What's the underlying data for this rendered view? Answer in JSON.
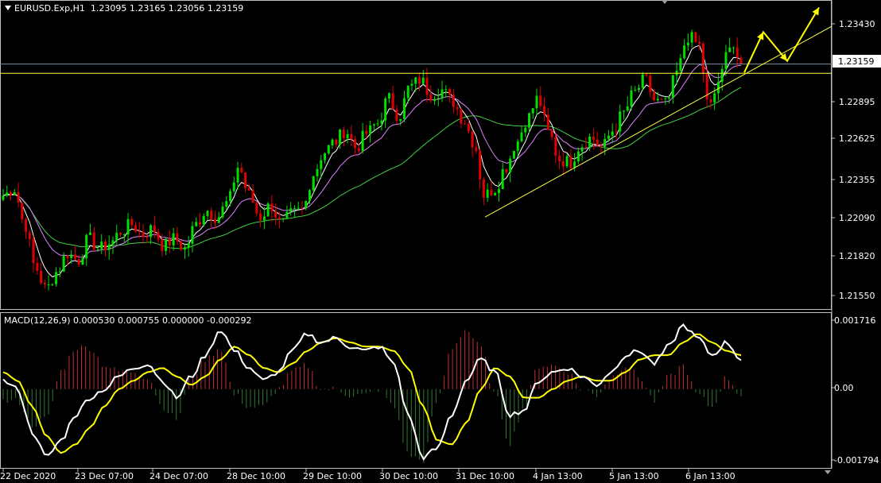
{
  "price_pane": {
    "symbol": "EURUSD.Exp,H1",
    "ohlc": "1.23095 1.23165 1.23056 1.23159",
    "current_price_label": "1.23159",
    "y_ticks": [
      "1.23430",
      "1.23159",
      "1.22895",
      "1.22625",
      "1.22355",
      "1.22090",
      "1.21820",
      "1.21550"
    ]
  },
  "macd_pane": {
    "title": "MACD(12,26,9) 0.000530 0.000755 0.000000 -0.000292",
    "y_ticks": [
      "0.001716",
      "0.00",
      "-0.001794"
    ]
  },
  "time_axis": {
    "labels": [
      "22 Dec 2020",
      "23 Dec 07:00",
      "24 Dec 07:00",
      "28 Dec 10:00",
      "29 Dec 10:00",
      "30 Dec 10:00",
      "31 Dec 10:00",
      "4 Jan 13:00",
      "5 Jan 13:00",
      "6 Jan 13:00"
    ]
  },
  "colors": {
    "background": "#000000",
    "bull_candle": "#00e000",
    "bear_candle": "#e00000",
    "macd_line": "#ffffff",
    "signal_line": "#ffff00",
    "hist_positive": "#c03030",
    "hist_negative": "#2f7a2f",
    "ma_white": "#ffffff",
    "ma_violet": "#e080ff",
    "ma_green": "#40d040",
    "horizontal_level": "#ffff40",
    "trendline": "#ffff40",
    "arrow": "#ffff00",
    "grid_line": "#8090a0"
  },
  "chart_data": [
    {
      "type": "candlestick",
      "symbol": "EURUSD.Exp",
      "timeframe": "H1",
      "ylim": [
        1.2148,
        1.2358
      ],
      "last_price": 1.23159,
      "horizontal_level": 1.23095,
      "trendline": {
        "from": [
          "31 Dec 2020",
          1.221
        ],
        "to": [
          "6 Jan 2021",
          1.232
        ]
      },
      "projection_arrows": [
        1.231,
        1.2338,
        1.2318,
        1.2355
      ],
      "close_profile": [
        1.2225,
        1.223,
        1.2205,
        1.2175,
        1.216,
        1.2172,
        1.2185,
        1.218,
        1.2195,
        1.2188,
        1.2192,
        1.22,
        1.2205,
        1.2198,
        1.2202,
        1.219,
        1.2195,
        1.2188,
        1.2205,
        1.2215,
        1.221,
        1.222,
        1.2245,
        1.2225,
        1.221,
        1.2218,
        1.2205,
        1.2212,
        1.2215,
        1.224,
        1.2255,
        1.2262,
        1.227,
        1.2258,
        1.2268,
        1.2275,
        1.2292,
        1.228,
        1.23,
        1.2305,
        1.2295,
        1.2298,
        1.229,
        1.2278,
        1.2262,
        1.2225,
        1.223,
        1.2245,
        1.2262,
        1.2278,
        1.2292,
        1.2268,
        1.225,
        1.2248,
        1.226,
        1.2265,
        1.2258,
        1.227,
        1.2282,
        1.2296,
        1.2305,
        1.229,
        1.2288,
        1.231,
        1.2335,
        1.233,
        1.2285,
        1.2305,
        1.2332,
        1.2316
      ],
      "moving_averages": [
        {
          "color": "white",
          "period": "fast"
        },
        {
          "color": "violet",
          "period": "medium"
        },
        {
          "color": "green",
          "period": "slow"
        }
      ]
    },
    {
      "type": "line",
      "indicator": "MACD(12,26,9)",
      "values": {
        "main": 0.00053,
        "signal": 0.000755,
        "third": 0.0,
        "histogram": -0.000292
      },
      "ylim": [
        -0.001794,
        0.001716
      ],
      "macd_profile": [
        0.0002,
        0.0,
        -0.001,
        -0.0016,
        -0.0012,
        -0.0006,
        -0.0002,
        0.0,
        0.0003,
        0.0005,
        0.0006,
        0.0002,
        -0.0002,
        0.0003,
        0.0008,
        0.0014,
        0.0009,
        0.0005,
        0.0002,
        0.0004,
        0.0009,
        0.0013,
        0.0011,
        0.0012,
        0.001,
        0.0009,
        0.001,
        0.0006,
        -0.0006,
        -0.0016,
        -0.0014,
        -0.0006,
        0.0002,
        0.0007,
        0.0004,
        -0.0006,
        -0.0005,
        0.0002,
        0.0004,
        0.0005,
        0.0003,
        0.0001,
        0.0004,
        0.0008,
        0.0009,
        0.0006,
        0.001,
        0.0015,
        0.0012,
        0.0008,
        0.0011,
        0.0007
      ],
      "signal_profile": [
        0.0004,
        0.0002,
        -0.0004,
        -0.0011,
        -0.0015,
        -0.0013,
        -0.0009,
        -0.0004,
        0.0,
        0.0002,
        0.0004,
        0.0005,
        0.0003,
        0.0001,
        0.0003,
        0.0007,
        0.001,
        0.0008,
        0.0005,
        0.0004,
        0.0006,
        0.0009,
        0.0011,
        0.0012,
        0.0011,
        0.001,
        0.001,
        0.0009,
        0.0005,
        -0.0004,
        -0.0012,
        -0.0013,
        -0.0008,
        0.0,
        0.0005,
        0.0003,
        -0.0002,
        -0.0002,
        0.0,
        0.0002,
        0.0003,
        0.0002,
        0.0002,
        0.0004,
        0.0007,
        0.0008,
        0.0008,
        0.0011,
        0.0013,
        0.0011,
        0.0009,
        0.0008
      ]
    }
  ]
}
